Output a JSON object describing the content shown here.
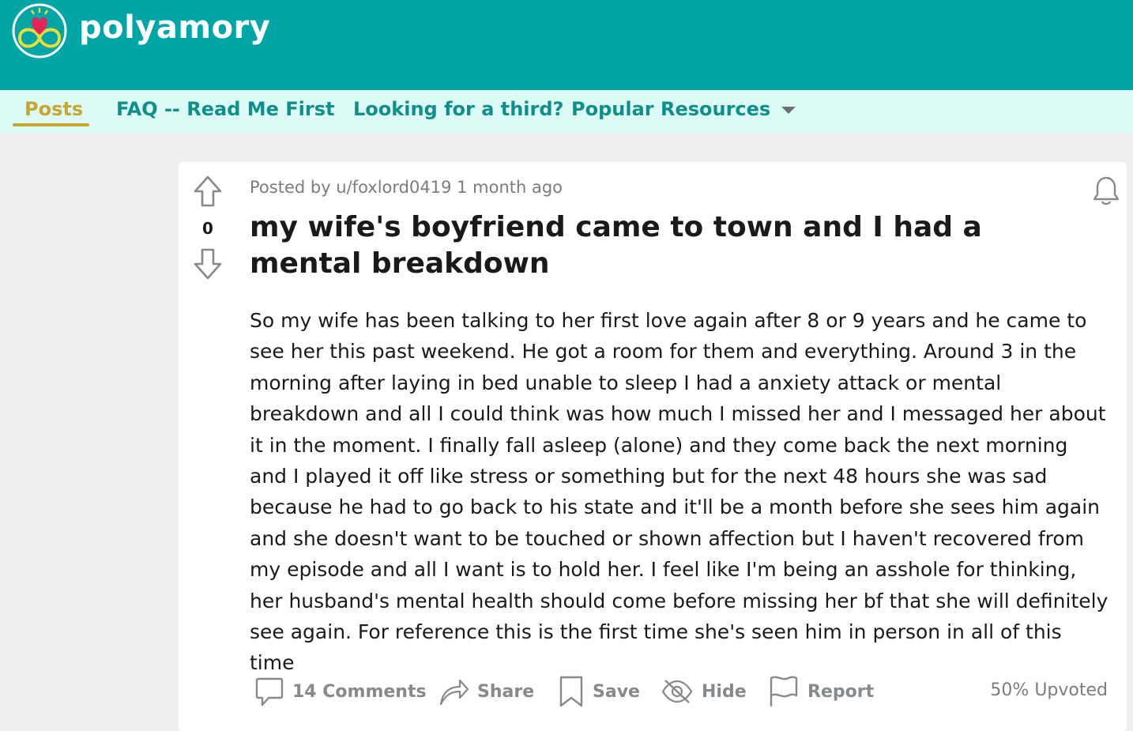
{
  "subreddit": {
    "name": "polyamory",
    "brand_color": "#00a6a6",
    "nav_bg": "#dcfbf6",
    "active_color": "#c8a630",
    "logo_icon": "infinity-heart-logo"
  },
  "nav": {
    "items": [
      {
        "label": "Posts",
        "active": true
      },
      {
        "label": "FAQ -- Read Me First",
        "active": false
      },
      {
        "label": "Looking for a third?",
        "active": false
      },
      {
        "label": "Popular Resources",
        "active": false,
        "icon": "chevron-down-icon"
      }
    ]
  },
  "post": {
    "votes": "0",
    "meta": "Posted by u/foxlord0419 1 month ago",
    "title": "my wife's boyfriend came to town and I had a mental breakdown",
    "body": "So my wife has been talking to her first love again after 8 or 9 years and he came to see her this past weekend. He got a room for them and everything. Around 3 in the morning after laying in bed unable to sleep I had a anxiety attack or mental breakdown and all I could think was how much I missed her and I messaged her about it in the moment. I finally fall asleep (alone) and they come back the next morning and I played it off like stress or something but for the next 48 hours she was sad because he had to go back to his state and it'll be a month before she sees him again and she doesn't want to be touched or shown affection but I haven't recovered from my episode and all I want is to hold her. I feel like I'm being an asshole for thinking, her husband's mental health should come before missing her bf that she will definitely see again. For reference this is the first time she's seen him in person in all of this time",
    "actions": {
      "comments": "14 Comments",
      "share": "Share",
      "save": "Save",
      "hide": "Hide",
      "report": "Report"
    },
    "upvoted": "50% Upvoted"
  }
}
